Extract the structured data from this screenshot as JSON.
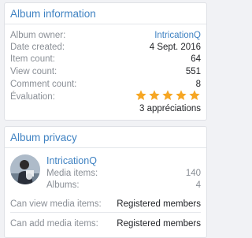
{
  "album_information": {
    "title": "Album information",
    "owner_label": "Album owner:",
    "owner_value": "IntricationQ",
    "date_label": "Date created:",
    "date_value": "4 Sept. 2016",
    "item_count_label": "Item count:",
    "item_count_value": "64",
    "view_count_label": "View count:",
    "view_count_value": "551",
    "comment_count_label": "Comment count:",
    "comment_count_value": "8",
    "rating_label": "Évaluation:",
    "rating_stars": 5,
    "rating_max": 5,
    "star_color": "#f6a623",
    "appreciations": "3 appréciations"
  },
  "album_privacy": {
    "title": "Album privacy",
    "user": {
      "name": "IntricationQ",
      "avatar_icon": "user-avatar-photo",
      "media_items_label": "Media items:",
      "media_items_value": "140",
      "albums_label": "Albums:",
      "albums_value": "4"
    },
    "can_view_label": "Can view media items:",
    "can_view_value": "Registered members",
    "can_add_label": "Can add media items:",
    "can_add_value": "Registered members"
  },
  "colors": {
    "accent": "#3f82c2",
    "muted_text": "#8a8f96",
    "body_text": "#222428",
    "background": "#f1f2f5"
  }
}
